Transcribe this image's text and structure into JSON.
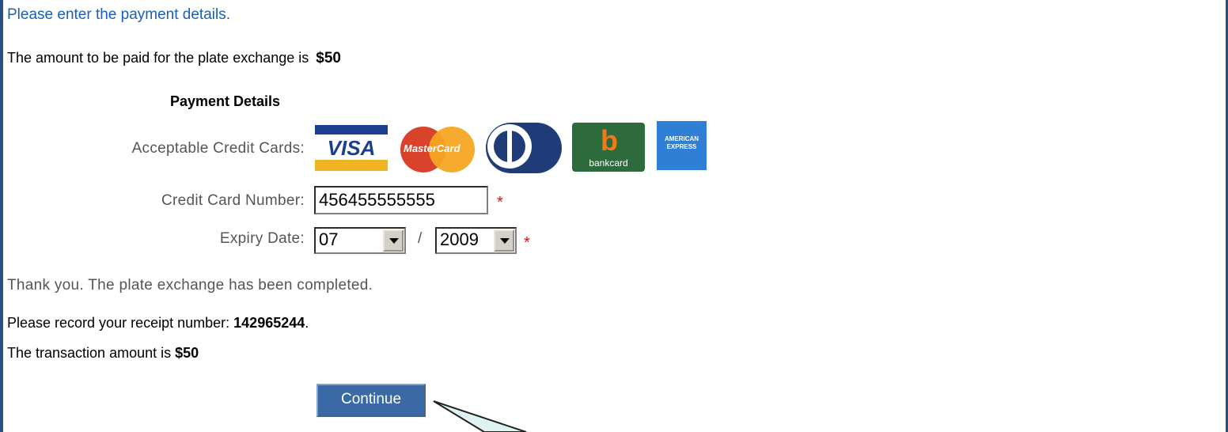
{
  "intro": "Please enter the payment details.",
  "amount": {
    "text": "The amount to be paid for the plate exchange is",
    "value": "$50"
  },
  "payment_details": {
    "heading": "Payment Details",
    "cards_label": "Acceptable Credit Cards:",
    "cards": [
      {
        "name": "visa",
        "text": "VISA"
      },
      {
        "name": "mastercard",
        "text": "MasterCard"
      },
      {
        "name": "diners",
        "text": ""
      },
      {
        "name": "bankcard",
        "text": "bankcard"
      },
      {
        "name": "amex",
        "text": "AMERICAN EXPRESS"
      }
    ],
    "ccn_label": "Credit Card Number:",
    "ccn_value": "456455555555",
    "expiry_label": "Expiry Date:",
    "expiry_month": "07",
    "expiry_separator": "/",
    "expiry_year": "2009",
    "required_marker": "*"
  },
  "result": {
    "thanks": "Thank you. The plate exchange has been completed.",
    "receipt_text": "Please record your receipt number:",
    "receipt_number": "142965244",
    "receipt_suffix": ".",
    "txn_text": "The transaction amount is",
    "txn_value": "$50"
  },
  "continue_label": "Continue",
  "colors": {
    "frame": "#2a4f82",
    "button": "#3a6aa6",
    "intro_text": "#1a5fb4",
    "required": "#e01010"
  }
}
